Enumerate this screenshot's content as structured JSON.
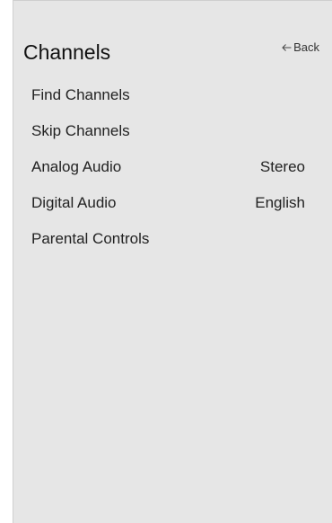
{
  "header": {
    "title": "Channels",
    "back_label": "Back",
    "back_icon": "arrow-left-icon"
  },
  "menu": {
    "items": [
      {
        "label": "Find Channels",
        "value": ""
      },
      {
        "label": "Skip Channels",
        "value": ""
      },
      {
        "label": "Analog Audio",
        "value": "Stereo"
      },
      {
        "label": "Digital Audio",
        "value": "English"
      },
      {
        "label": "Parental Controls",
        "value": ""
      }
    ]
  },
  "colors": {
    "panel_background": "#e6e6e6",
    "page_background": "#ffffff",
    "text": "#222222"
  }
}
